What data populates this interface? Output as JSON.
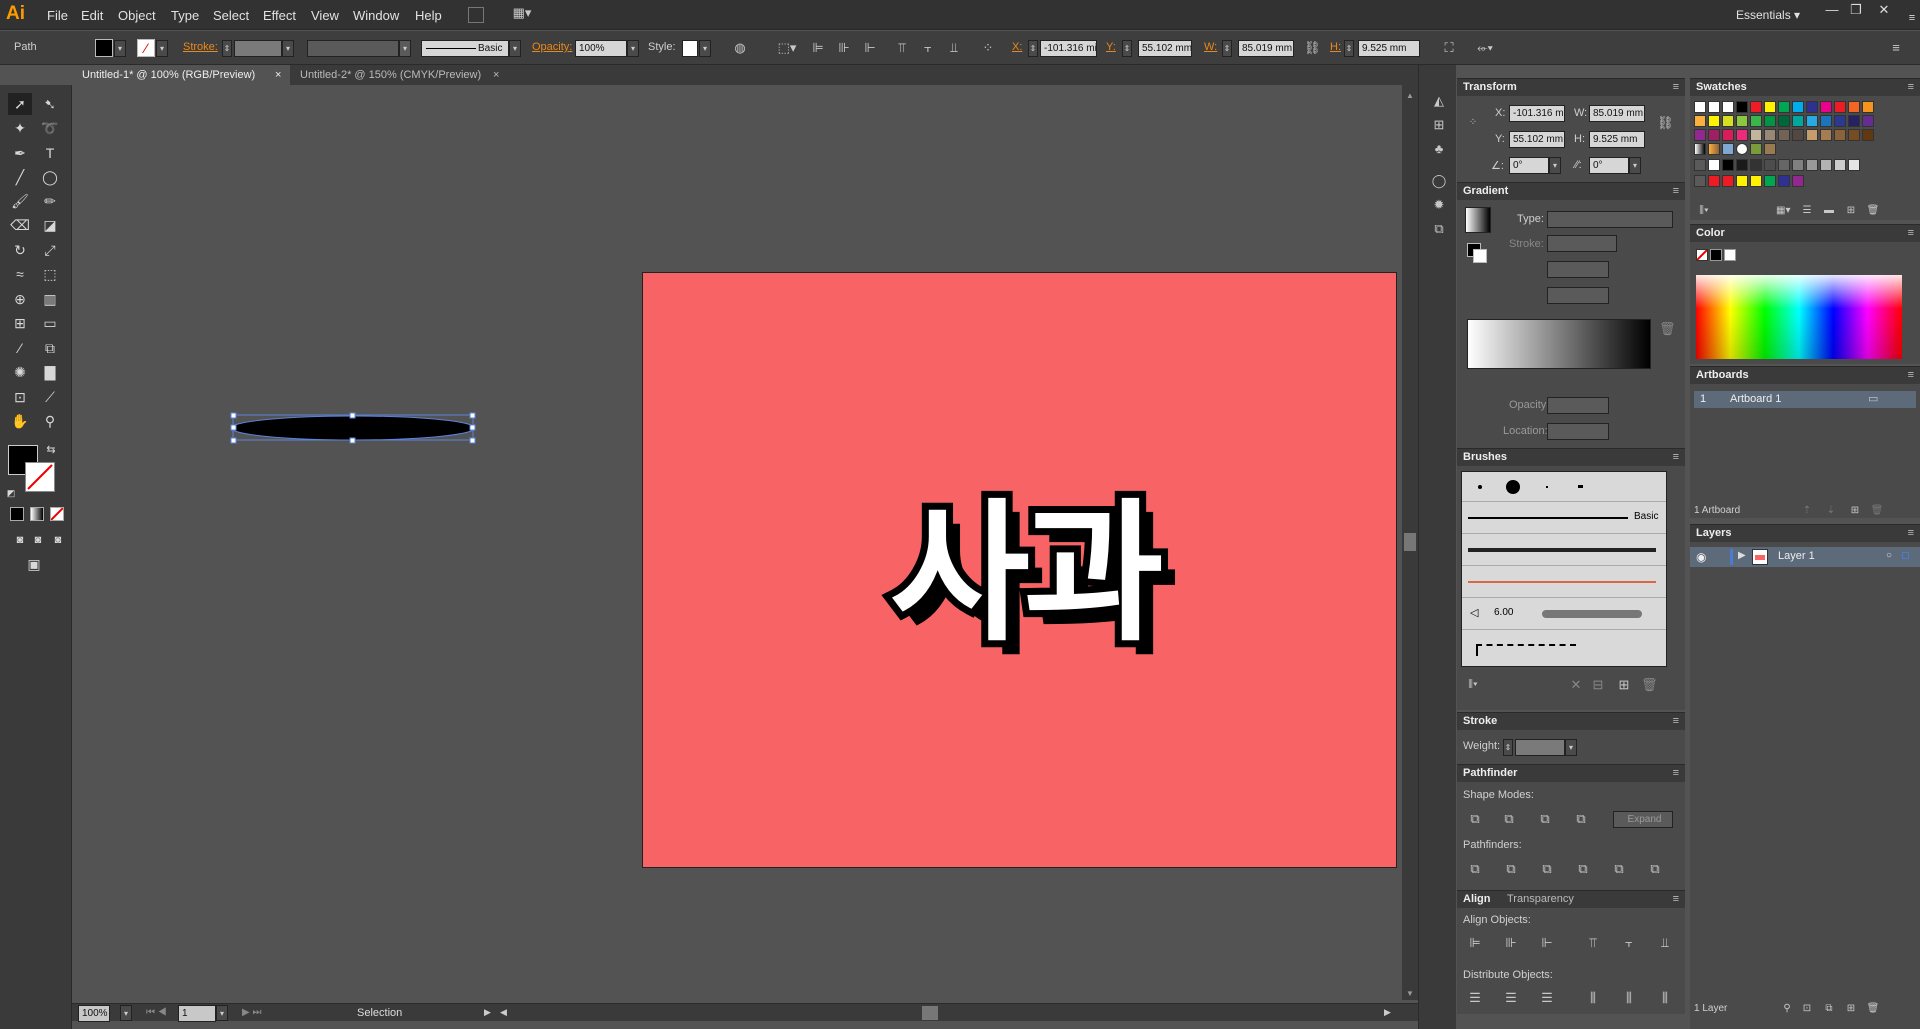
{
  "app": {
    "logo": "Ai",
    "workspace": "Essentials"
  },
  "menu": [
    "File",
    "Edit",
    "Object",
    "Type",
    "Select",
    "Effect",
    "View",
    "Window",
    "Help"
  ],
  "control": {
    "selection_type": "Path",
    "stroke_label": "Stroke:",
    "brush": "Basic",
    "opacity_label": "Opacity:",
    "opacity": "100%",
    "style_label": "Style:",
    "x_label": "X:",
    "x": "-101.316 mi",
    "y_label": "Y:",
    "y": "55.102 mm",
    "w_label": "W:",
    "w": "85.019 mm",
    "h_label": "H:",
    "h": "9.525 mm"
  },
  "tabs": [
    "Untitled-1* @ 100% (RGB/Preview)",
    "Untitled-2* @ 150% (CMYK/Preview)"
  ],
  "artwork": {
    "text": "사과",
    "artboard_color": "#f86465"
  },
  "status": {
    "zoom": "100%",
    "artboard_nav": "1",
    "tool": "Selection"
  },
  "transform": {
    "title": "Transform",
    "x_label": "X:",
    "x": "-101.316 mm",
    "y_label": "Y:",
    "y": "55.102 mm",
    "w_label": "W:",
    "w": "85.019 mm",
    "h_label": "H:",
    "h": "9.525 mm",
    "angle": "0°",
    "shear": "0°"
  },
  "gradient": {
    "title": "Gradient",
    "type_label": "Type:",
    "stroke_label": "Stroke:",
    "opacity_label": "Opacity:",
    "location_label": "Location:"
  },
  "brushes": {
    "title": "Brushes",
    "basic": "Basic",
    "size": "6.00"
  },
  "stroke": {
    "title": "Stroke",
    "weight_label": "Weight:"
  },
  "pathfinder": {
    "title": "Pathfinder",
    "shape_modes": "Shape Modes:",
    "expand": "Expand",
    "pathfinders": "Pathfinders:"
  },
  "align": {
    "title": "Align",
    "tab2": "Transparency",
    "align_objects": "Align Objects:",
    "distribute_objects": "Distribute Objects:"
  },
  "swatches": {
    "title": "Swatches"
  },
  "color": {
    "title": "Color"
  },
  "artboards": {
    "title": "Artboards",
    "rows": [
      {
        "num": "1",
        "name": "Artboard 1"
      }
    ],
    "count": "1 Artboard"
  },
  "layers": {
    "title": "Layers",
    "rows": [
      {
        "name": "Layer 1"
      }
    ],
    "count": "1 Layer"
  }
}
